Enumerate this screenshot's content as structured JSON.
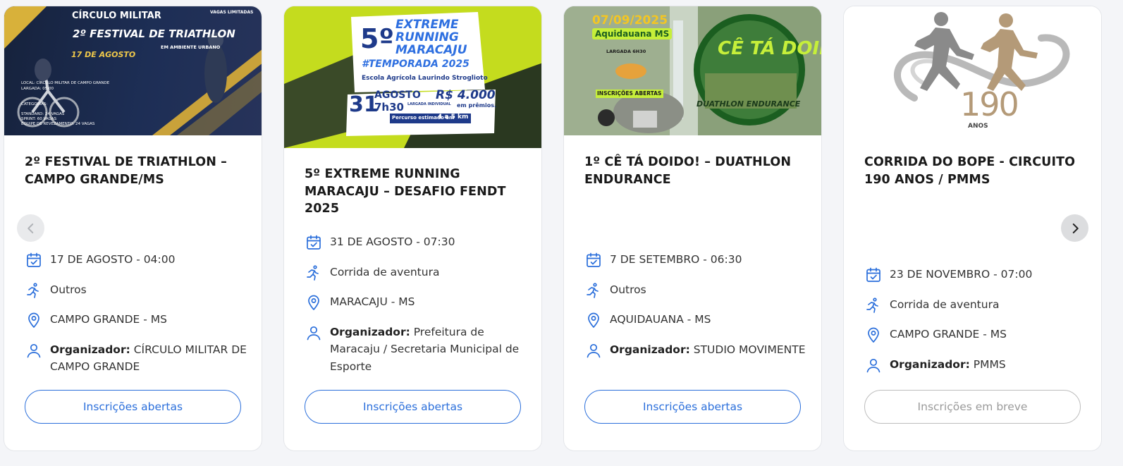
{
  "cards": [
    {
      "title": "2º FESTIVAL DE TRIATHLON – CAMPO GRANDE/MS",
      "date": "17 DE AGOSTO - 04:00",
      "sport": "Outros",
      "location": "CAMPO GRANDE - MS",
      "organizer_label": "Organizador:",
      "organizer": "CÍRCULO MILITAR DE CAMPO GRANDE",
      "button": "Inscrições abertas",
      "banner": {
        "top": "CÍRCULO MILITAR",
        "tag": "VAGAS LIMITADAS",
        "headline": "2º FESTIVAL DE TRIATHLON",
        "sub": "EM AMBIENTE URBANO",
        "date": "17 DE AGOSTO",
        "local": "LOCAL: CÍRCULO MILITAR DE CAMPO GRANDE",
        "largada": "LARGADA: 05:00",
        "cat": "CATEGORIAS:",
        "cat1": "STANDARD: 24 VAGAS",
        "cat2": "SPRINT: 60 VAGAS",
        "cat3": "EQUIPE DE REVEZAMENTO: 24 VAGAS"
      }
    },
    {
      "title": "5º EXTREME RUNNING MARACAJU – DESAFIO FENDT 2025",
      "date": "31 DE AGOSTO - 07:30",
      "sport": "Corrida de aventura",
      "location": "MARACAJU - MS",
      "organizer_label": "Organizador:",
      "organizer": "Prefeitura de Maracaju / Secretaria Municipal de Esporte",
      "button": "Inscrições abertas",
      "banner": {
        "num": "5º",
        "l1": "EXTREME",
        "l2": "RUNNING",
        "l3": "MARACAJU",
        "season": "#TEMPORADA 2025",
        "school": "Escola Agrícola Laurindo Stroglioto",
        "day": "31",
        "month": "AGOSTO",
        "time": "7h30",
        "start": "LARGADA INDIVIDUAL",
        "prize": "R$ 4.000",
        "prize_sub": "em prêmios.",
        "route": "Percurso estimado em",
        "km": "4 a 5 km"
      }
    },
    {
      "title": "1º CÊ TÁ DOIDO! – DUATHLON ENDURANCE",
      "date": "7 DE SETEMBRO - 06:30",
      "sport": "Outros",
      "location": "AQUIDAUANA - MS",
      "organizer_label": "Organizador:",
      "organizer": "STUDIO MOVIMENTE",
      "button": "Inscrições abertas",
      "banner": {
        "date": "07/09/2025",
        "city": "Aquidauana MS",
        "start": "LARGADA 6H30",
        "insc": "INSCRIÇÕES ABERTAS",
        "logo": "CÊ TÁ DOIDO!",
        "event": "DUATHLON ENDURANCE"
      }
    },
    {
      "title": "CORRIDA DO BOPE - CIRCUITO 190 ANOS / PMMS",
      "date": "23 DE NOVEMBRO - 07:00",
      "sport": "Corrida de aventura",
      "location": "CAMPO GRANDE - MS",
      "organizer_label": "Organizador:",
      "organizer": "PMMS",
      "button": "Inscrições em breve",
      "banner": {
        "num": "190",
        "sub": "ANOS"
      }
    }
  ],
  "colors": {
    "accent": "#2b6fdb",
    "disabled": "#9a9a9a"
  },
  "nav": {
    "prev": "chevron-left-icon",
    "next": "chevron-right-icon"
  }
}
